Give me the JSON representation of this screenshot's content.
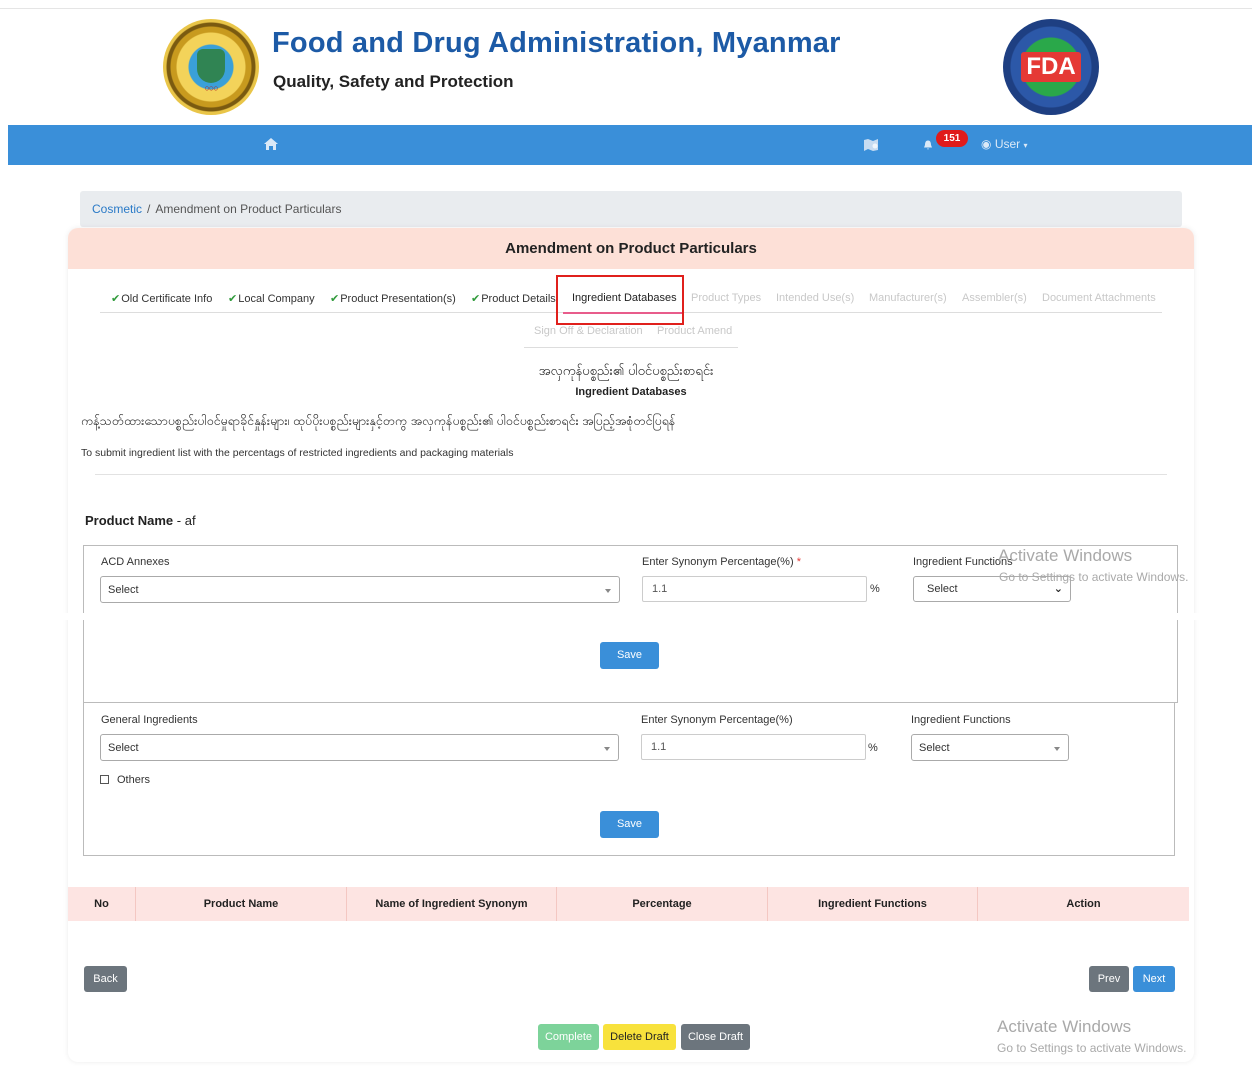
{
  "header": {
    "title": "Food and Drug Administration, Myanmar",
    "subtitle": "Quality, Safety and Protection",
    "right_logo_text": "FDA"
  },
  "navbar": {
    "home_icon": "home-icon",
    "map_icon": "map-icon",
    "bell_icon": "bell-icon",
    "notification_count": "151",
    "user_label": "User",
    "accent": "#3a8fd9"
  },
  "breadcrumb": {
    "root": "Cosmetic",
    "separator": "/",
    "current": "Amendment on Product Particulars"
  },
  "card": {
    "title": "Amendment on Product Particulars"
  },
  "tabs": [
    {
      "label": "Old Certificate Info",
      "state": "done"
    },
    {
      "label": "Local Company",
      "state": "done"
    },
    {
      "label": "Product Presentation(s)",
      "state": "done"
    },
    {
      "label": "Product Details",
      "state": "done"
    },
    {
      "label": "Ingredient Databases",
      "state": "active"
    },
    {
      "label": "Product Types",
      "state": "disabled"
    },
    {
      "label": "Intended Use(s)",
      "state": "disabled"
    },
    {
      "label": "Manufacturer(s)",
      "state": "disabled"
    },
    {
      "label": "Assembler(s)",
      "state": "disabled"
    },
    {
      "label": "Document Attachments",
      "state": "disabled"
    },
    {
      "label": "Sign Off & Declaration",
      "state": "disabled"
    },
    {
      "label": "Product Amend",
      "state": "disabled"
    }
  ],
  "section": {
    "title_my": "အလှကုန်ပစ္စည်း၏ ပါဝင်ပစ္စည်းစာရင်း",
    "title_en": "Ingredient Databases",
    "instruction_my": "ကန့်သတ်ထားသောပစ္စည်းပါဝင်မှုရာခိုင်နှုန်းများ၊ ထုပ်ပိုးပစ္စည်းများနှင့်တကွ အလှကုန်ပစ္စည်း၏ ပါဝင်ပစ္စည်းစာရင်း အပြည့်အစုံတင်ပြရန်",
    "instruction_en": "To submit ingredient list with the percentags of restricted ingredients and packaging materials"
  },
  "product": {
    "label": "Product Name",
    "dash": "-",
    "value": "af"
  },
  "acd_form": {
    "annex_label": "ACD Annexes",
    "annex_value": "Select",
    "percent_label": "Enter Synonym Percentage(%)",
    "required_mark": "*",
    "percent_value": "1.1",
    "percent_unit": "%",
    "function_label": "Ingredient Functions",
    "function_value": "Select",
    "save_label": "Save"
  },
  "general_form": {
    "ingredient_label": "General Ingredients",
    "ingredient_value": "Select",
    "percent_label": "Enter Synonym Percentage(%)",
    "percent_value": "1.1",
    "percent_unit": "%",
    "function_label": "Ingredient Functions",
    "function_value": "Select",
    "others_label": "Others",
    "save_label": "Save"
  },
  "table": {
    "columns": [
      "No",
      "Product Name",
      "Name of Ingredient Synonym",
      "Percentage",
      "Ingredient Functions",
      "Action"
    ]
  },
  "footer": {
    "back_label": "Back",
    "prev_label": "Prev",
    "next_label": "Next",
    "complete_label": "Complete",
    "delete_draft_label": "Delete Draft",
    "close_draft_label": "Close Draft"
  },
  "watermark": {
    "title": "Activate Windows",
    "sub": "Go to Settings to activate Windows."
  }
}
